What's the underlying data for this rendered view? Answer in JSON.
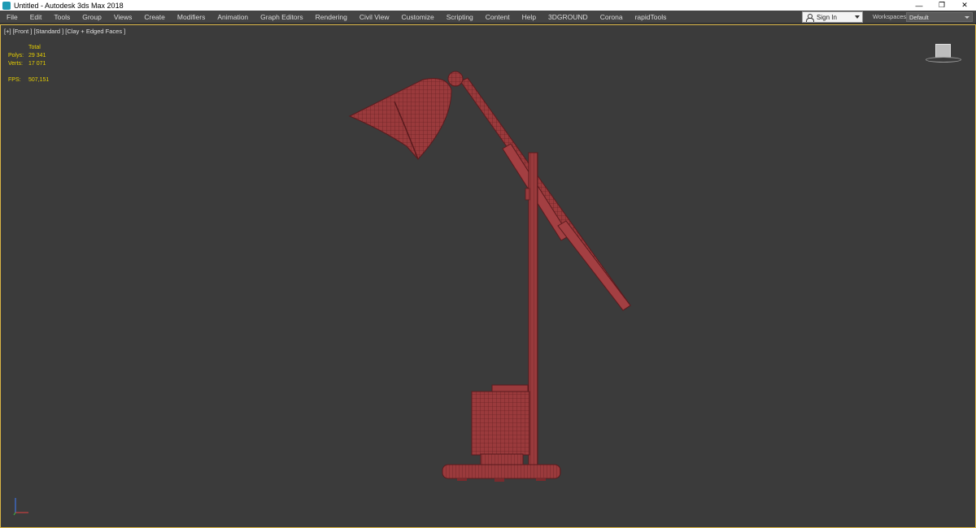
{
  "window": {
    "title": "Untitled - Autodesk 3ds Max 2018",
    "controls": {
      "minimize": "—",
      "restore": "❐",
      "close": "✕"
    }
  },
  "menu": {
    "items": [
      "File",
      "Edit",
      "Tools",
      "Group",
      "Views",
      "Create",
      "Modifiers",
      "Animation",
      "Graph Editors",
      "Rendering",
      "Civil View",
      "Customize",
      "Scripting",
      "Content",
      "Help",
      "3DGROUND",
      "Corona",
      "rapidTools"
    ],
    "sign_in": "Sign In",
    "workspaces_label": "Workspaces:",
    "workspaces_value": "Default"
  },
  "viewport": {
    "label": "[+] [Front ] [Standard ] [Clay + Edged Faces ]",
    "stats": {
      "total_label": "Total",
      "polys_label": "Polys:",
      "polys_value": "29 341",
      "verts_label": "Verts:",
      "verts_value": "17 071",
      "fps_label": "FPS:",
      "fps_value": "507,151"
    }
  },
  "colors": {
    "model": "#9a3a3c",
    "model_dark": "#5a1b1e",
    "accent_border": "#d9b545",
    "stats_text": "#e8d000"
  },
  "icons": {
    "app": "3dsmax-app-icon",
    "user": "user-icon",
    "viewcube": "viewcube-icon",
    "axis": "axis-tripod-icon"
  }
}
